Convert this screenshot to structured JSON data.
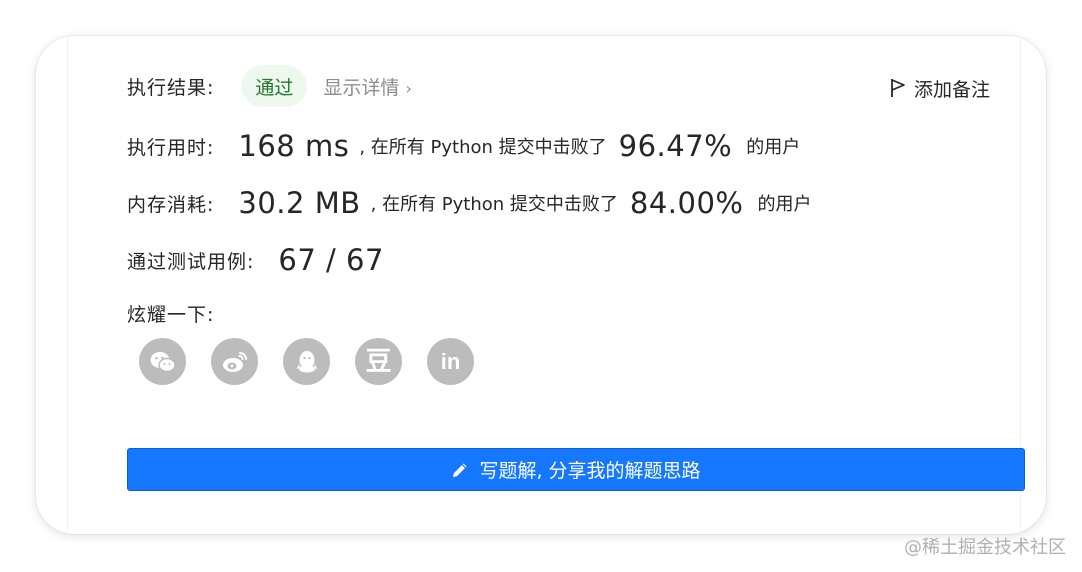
{
  "result": {
    "label": "执行结果:",
    "status": "通过",
    "detail_link": "显示详情",
    "chevron": "›",
    "add_note": "添加备注"
  },
  "runtime": {
    "label": "执行用时:",
    "value": "168 ms",
    "mid_text": ", 在所有 Python 提交中击败了",
    "percent": "96.47%",
    "suffix": "的用户"
  },
  "memory": {
    "label": "内存消耗:",
    "value": "30.2 MB",
    "mid_text": ", 在所有 Python 提交中击败了",
    "percent": "84.00%",
    "suffix": "的用户"
  },
  "testcases": {
    "label": "通过测试用例:",
    "value": "67 / 67"
  },
  "share": {
    "label": "炫耀一下:",
    "icons": [
      "wechat-icon",
      "weibo-icon",
      "qq-icon",
      "douban-icon",
      "linkedin-icon"
    ],
    "douban_glyph": "豆",
    "linkedin_glyph": "in"
  },
  "cta": {
    "label": "写题解, 分享我的解题思路",
    "icon": "pencil-icon"
  },
  "watermark": "@稀土掘金技术社区",
  "colors": {
    "accent": "#1677ff",
    "pass_bg": "#eff8ef",
    "pass_text": "#1f7a2e",
    "share_icon_bg": "#bcbcbc"
  }
}
